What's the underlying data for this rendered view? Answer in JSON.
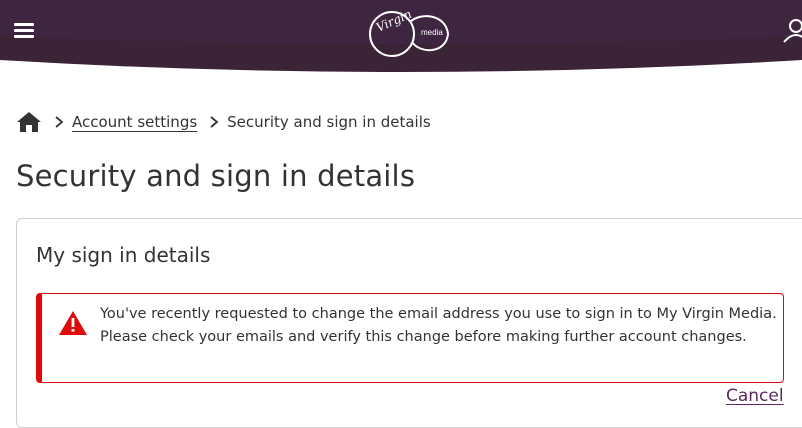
{
  "colors": {
    "header_bg": "#3c2438",
    "text": "#333333",
    "alert_border": "#e10a0a",
    "link": "#5a2a5e",
    "card_border": "#cfcfcf"
  },
  "header": {
    "menu_icon": "hamburger-menu-icon",
    "logo": {
      "virgin": "Virgin",
      "media": "media"
    },
    "account_icon": "user-account-icon"
  },
  "breadcrumb": {
    "home_icon": "home-icon",
    "separator_icon": "chevron-right-icon",
    "items": [
      {
        "label": "Account settings"
      },
      {
        "label": "Security and sign in details"
      }
    ]
  },
  "page": {
    "title": "Security and sign in details"
  },
  "card": {
    "title": "My sign in details",
    "alert": {
      "icon": "warning-triangle-icon",
      "message": "You've recently requested to change the email address you use to sign in to My Virgin Media. Please check your emails and verify this change before making further account changes."
    },
    "cancel_label": "Cancel"
  }
}
